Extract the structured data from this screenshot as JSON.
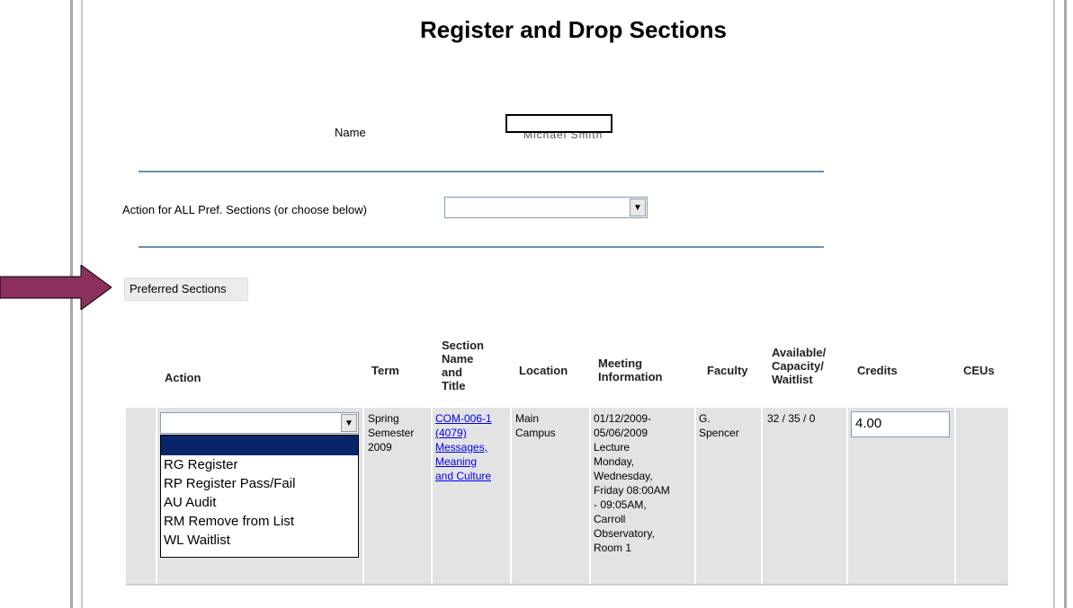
{
  "page": {
    "title": "Register and Drop Sections",
    "name_label": "Name",
    "name_value_obscured": "Michael Smith",
    "action_all_label": "Action for ALL Pref. Sections (or choose below)",
    "action_all_value": "",
    "preferred_sections_button": "Preferred Sections"
  },
  "table": {
    "headers": {
      "action": "Action",
      "term": "Term",
      "section": [
        "Section",
        "Name",
        "and",
        "Title"
      ],
      "location": "Location",
      "meeting": [
        "Meeting",
        "Information"
      ],
      "faculty": "Faculty",
      "capacity": [
        "Available/",
        "Capacity/",
        "Waitlist"
      ],
      "credits": "Credits",
      "ceus": "CEUs"
    },
    "row": {
      "action_value": "",
      "term": [
        "Spring",
        "Semester",
        "2009"
      ],
      "section_link": [
        "COM-006-1",
        "(4079)",
        "Messages,",
        "Meaning",
        "and Culture"
      ],
      "location": [
        "Main",
        "Campus"
      ],
      "meeting": [
        "01/12/2009-",
        "05/06/2009",
        "Lecture",
        "Monday,",
        "Wednesday,",
        "Friday 08:00AM",
        "- 09:05AM,",
        "Carroll",
        "Observatory,",
        "Room 1"
      ],
      "faculty": [
        "G.",
        "Spencer"
      ],
      "capacity": "32 / 35 / 0",
      "credits": "4.00",
      "ceus": ""
    }
  },
  "action_options": [
    "",
    "RG Register",
    "RP Register Pass/Fail",
    "AU Audit",
    "RM Remove from List",
    "WL Waitlist"
  ],
  "colors": {
    "arrow": "#8b2f5e",
    "selected_option": "#0a246a",
    "link": "#0000ee",
    "rule": "#6a8fb5"
  },
  "icons": {
    "dropdown": "dropdown-arrow-icon",
    "pointer": "pointer-arrow-icon"
  }
}
